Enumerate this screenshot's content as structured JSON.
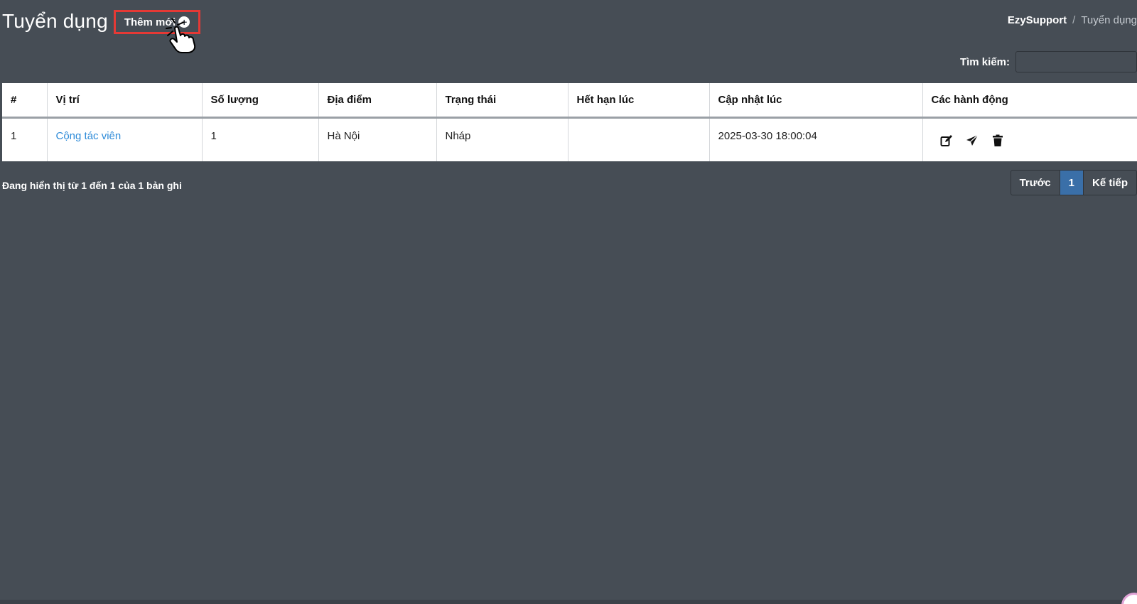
{
  "header": {
    "title": "Tuyển dụng",
    "add_label": "Thêm mới",
    "add_icon": "plus-circle-icon"
  },
  "breadcrumb": {
    "home": "EzySupport",
    "separator": "/",
    "current": "Tuyển dụng"
  },
  "search": {
    "label": "Tìm kiếm:",
    "value": "",
    "placeholder": ""
  },
  "table": {
    "columns": [
      "#",
      "Vị trí",
      "Số lượng",
      "Địa điểm",
      "Trạng thái",
      "Hết hạn lúc",
      "Cập nhật lúc",
      "Các hành động"
    ],
    "rows": [
      {
        "index": "1",
        "position": "Cộng tác viên",
        "quantity": "1",
        "location": "Hà Nội",
        "status": "Nháp",
        "expires_at": "",
        "updated_at": "2025-03-30 18:00:04",
        "actions": [
          "edit-icon",
          "send-icon",
          "trash-icon"
        ]
      }
    ]
  },
  "footer": {
    "info": "Đang hiển thị từ 1 đến 1 của 1 bản ghi"
  },
  "pagination": {
    "prev": "Trước",
    "current_page": "1",
    "next": "Kế tiếp"
  },
  "colors": {
    "background": "#464d55",
    "highlight_border": "#e53935",
    "link": "#2e8bd8",
    "active_page": "#3a6fa8"
  }
}
